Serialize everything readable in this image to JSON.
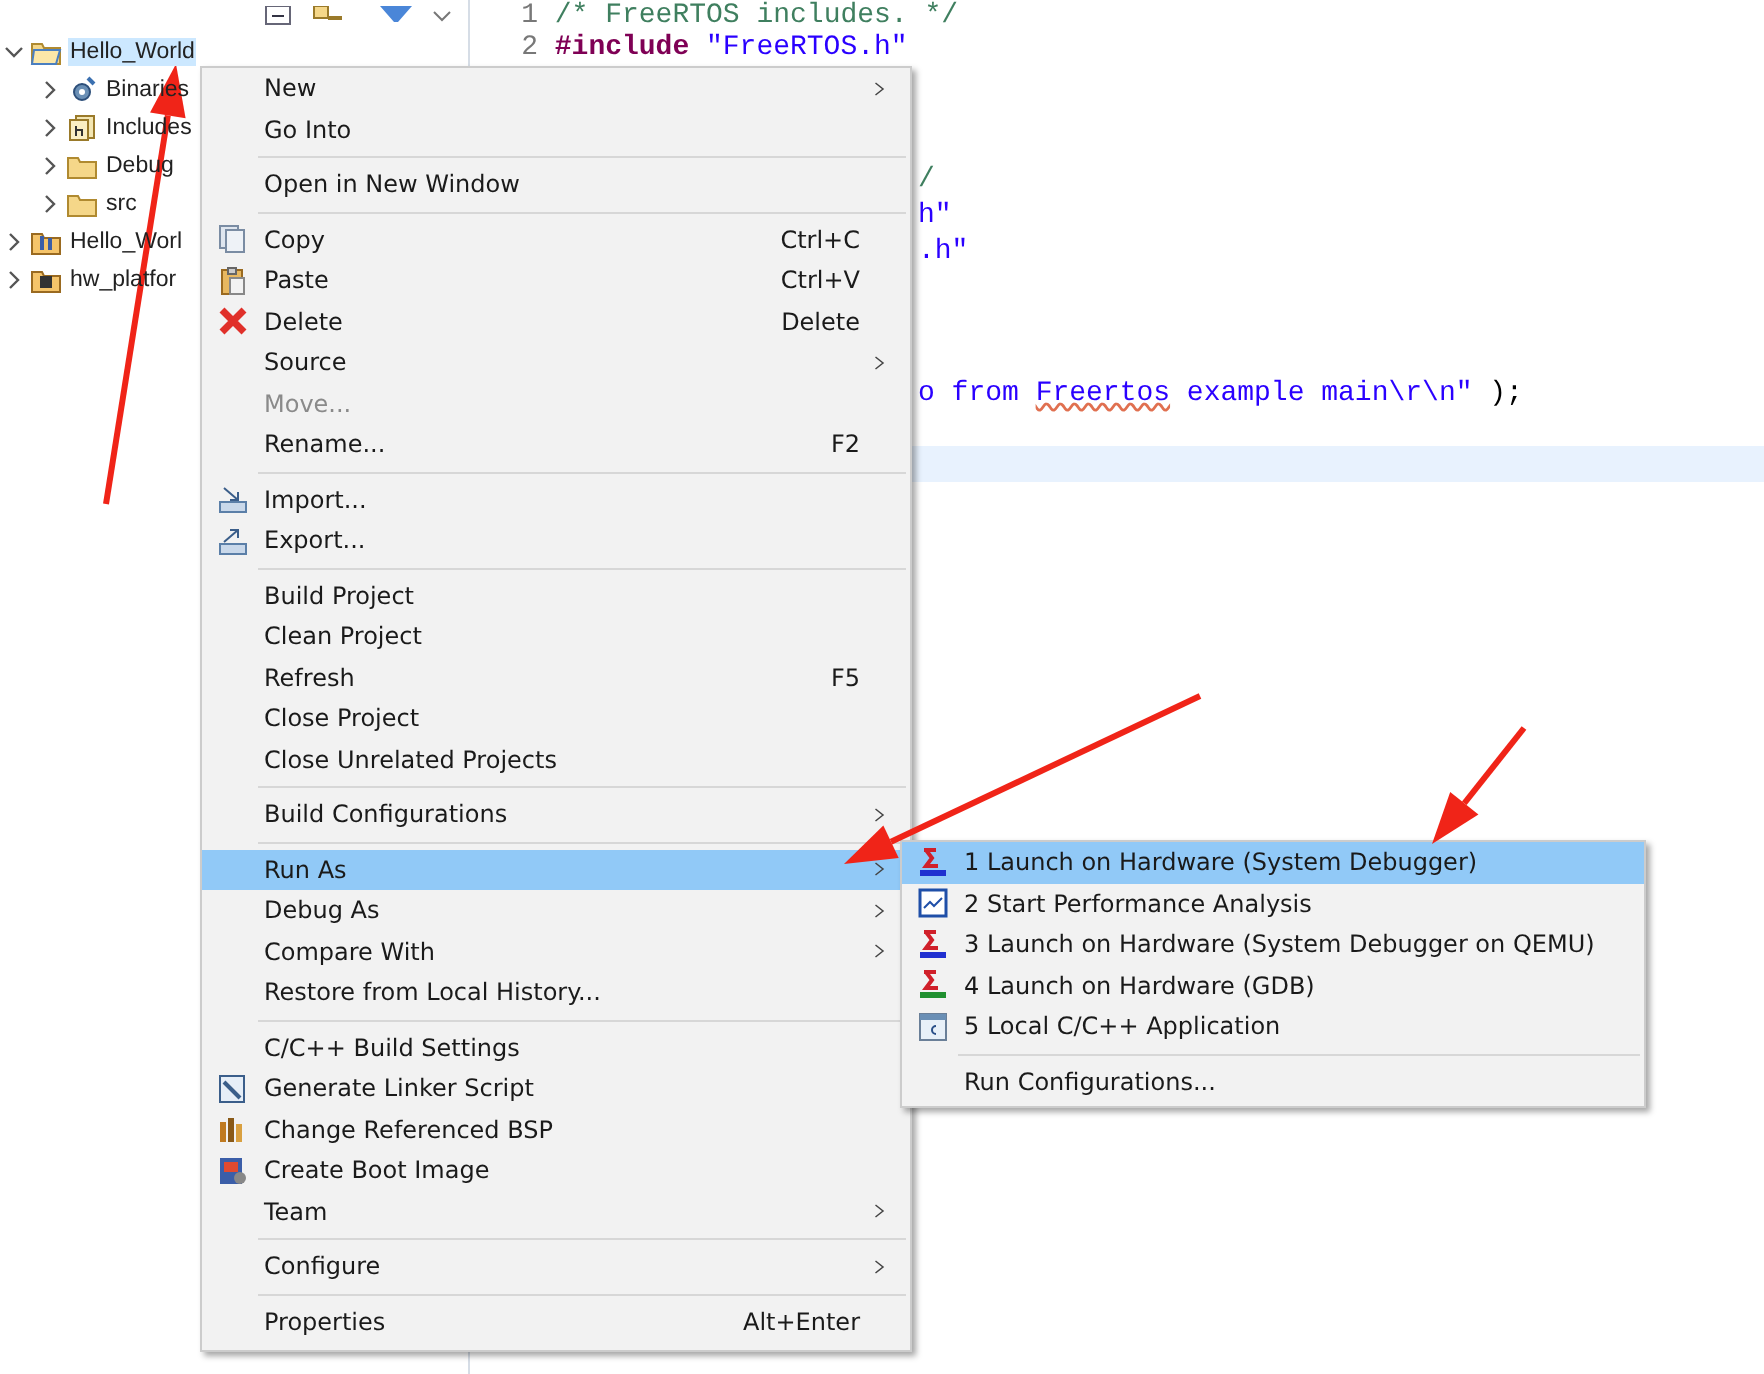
{
  "explorer": {
    "tree": [
      {
        "label": "Hello_World",
        "expanded": true,
        "selected": true,
        "children": [
          {
            "label": "Binaries",
            "expanded": false,
            "selected": false
          },
          {
            "label": "Includes",
            "expanded": false,
            "selected": false
          },
          {
            "label": "Debug",
            "expanded": false,
            "selected": false
          },
          {
            "label": "src",
            "expanded": false,
            "selected": false
          }
        ]
      },
      {
        "label": "Hello_Worl",
        "expanded": false,
        "selected": false
      },
      {
        "label": "hw_platfor",
        "expanded": false,
        "selected": false
      }
    ]
  },
  "editor": {
    "lines": [
      {
        "kind": "full",
        "number": "1",
        "parts": [
          {
            "kind": "comment",
            "text": "/* FreeRTOS includes. */"
          }
        ]
      },
      {
        "kind": "full",
        "number": "2",
        "parts": [
          {
            "kind": "keyword",
            "text": "#include"
          },
          {
            "kind": "string",
            "text": "\"FreeRTOS.h\""
          }
        ]
      },
      {
        "kind": "blank"
      },
      {
        "kind": "blank"
      },
      {
        "kind": "tail",
        "parts": [
          {
            "kind": "comment",
            "text": "/"
          }
        ]
      },
      {
        "kind": "tail",
        "parts": [
          {
            "kind": "string",
            "text": "h\""
          }
        ]
      },
      {
        "kind": "tail",
        "parts": [
          {
            "kind": "string",
            "text": ".h\""
          }
        ]
      },
      {
        "kind": "blank"
      },
      {
        "kind": "blank"
      },
      {
        "kind": "blank"
      },
      {
        "kind": "tail",
        "parts": [
          {
            "kind": "string",
            "text": "o from"
          },
          {
            "kind": "misspelled",
            "text": "Freertos"
          },
          {
            "kind": "string",
            "text": "example main\\r\\n\""
          },
          {
            "kind": "plain",
            "text": ");"
          }
        ]
      },
      {
        "kind": "blank"
      },
      {
        "kind": "current"
      }
    ]
  },
  "context_menu": {
    "items": [
      {
        "kind": "item",
        "label": "New",
        "submenu": true
      },
      {
        "kind": "item",
        "label": "Go Into"
      },
      {
        "kind": "separator"
      },
      {
        "kind": "item",
        "label": "Open in New Window"
      },
      {
        "kind": "separator"
      },
      {
        "kind": "item",
        "label": "Copy",
        "shortcut": "Ctrl+C"
      },
      {
        "kind": "item",
        "label": "Paste",
        "shortcut": "Ctrl+V"
      },
      {
        "kind": "item",
        "label": "Delete",
        "shortcut": "Delete"
      },
      {
        "kind": "item",
        "label": "Source",
        "submenu": true
      },
      {
        "kind": "item",
        "label": "Move...",
        "disabled": true
      },
      {
        "kind": "item",
        "label": "Rename...",
        "shortcut": "F2"
      },
      {
        "kind": "separator"
      },
      {
        "kind": "item",
        "label": "Import..."
      },
      {
        "kind": "item",
        "label": "Export..."
      },
      {
        "kind": "separator"
      },
      {
        "kind": "item",
        "label": "Build Project"
      },
      {
        "kind": "item",
        "label": "Clean Project"
      },
      {
        "kind": "item",
        "label": "Refresh",
        "shortcut": "F5"
      },
      {
        "kind": "item",
        "label": "Close Project"
      },
      {
        "kind": "item",
        "label": "Close Unrelated Projects"
      },
      {
        "kind": "separator"
      },
      {
        "kind": "item",
        "label": "Build Configurations",
        "submenu": true
      },
      {
        "kind": "separator"
      },
      {
        "kind": "item",
        "label": "Run As",
        "submenu": true,
        "selected": true
      },
      {
        "kind": "item",
        "label": "Debug As",
        "submenu": true
      },
      {
        "kind": "item",
        "label": "Compare With",
        "submenu": true
      },
      {
        "kind": "item",
        "label": "Restore from Local History..."
      },
      {
        "kind": "separator"
      },
      {
        "kind": "item",
        "label": "C/C++ Build Settings"
      },
      {
        "kind": "item",
        "label": "Generate Linker Script"
      },
      {
        "kind": "item",
        "label": "Change Referenced BSP"
      },
      {
        "kind": "item",
        "label": "Create Boot Image"
      },
      {
        "kind": "item",
        "label": "Team",
        "submenu": true
      },
      {
        "kind": "separator"
      },
      {
        "kind": "item",
        "label": "Configure",
        "submenu": true
      },
      {
        "kind": "separator"
      },
      {
        "kind": "item",
        "label": "Properties",
        "shortcut": "Alt+Enter"
      }
    ]
  },
  "run_as_submenu": {
    "items": [
      {
        "kind": "item",
        "label": "1 Launch on Hardware (System Debugger)",
        "selected": true
      },
      {
        "kind": "item",
        "label": "2 Start Performance Analysis",
        "selected": false
      },
      {
        "kind": "item",
        "label": "3 Launch on Hardware (System Debugger on QEMU)",
        "selected": false
      },
      {
        "kind": "item",
        "label": "4 Launch on Hardware (GDB)",
        "selected": false
      },
      {
        "kind": "item",
        "label": "5 Local C/C++ Application",
        "selected": false
      },
      {
        "kind": "separator"
      },
      {
        "kind": "item",
        "label": "Run Configurations...",
        "selected": false
      }
    ]
  }
}
